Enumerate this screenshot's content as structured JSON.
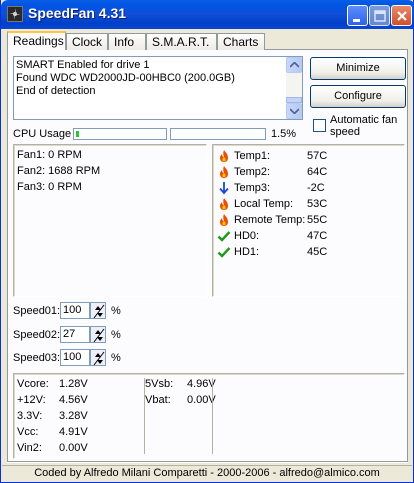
{
  "window": {
    "title": "SpeedFan 4.31"
  },
  "tabs": [
    {
      "label": "Readings",
      "active": true
    },
    {
      "label": "Clock"
    },
    {
      "label": "Info"
    },
    {
      "label": "S.M.A.R.T."
    },
    {
      "label": "Charts"
    }
  ],
  "log": {
    "lines": [
      "SMART Enabled for drive 1",
      "Found WDC WD2000JD-00HBC0 (200.0GB)",
      "End of detection"
    ]
  },
  "buttons": {
    "minimize": "Minimize",
    "configure": "Configure"
  },
  "auto_fan": {
    "label": "Automatic fan speed",
    "checked": false
  },
  "cpu": {
    "label": "CPU Usage",
    "percent_text": "1.5%",
    "cpu1_fraction": 0.03,
    "cpu2_fraction": 0.0
  },
  "fans": [
    {
      "text": "Fan1: 0 RPM"
    },
    {
      "text": "Fan2: 1688 RPM"
    },
    {
      "text": "Fan3: 0 RPM"
    }
  ],
  "temps": [
    {
      "label": "Temp1:",
      "value": "57C",
      "icon": "flame-icon"
    },
    {
      "label": "Temp2:",
      "value": "64C",
      "icon": "flame-icon"
    },
    {
      "label": "Temp3:",
      "value": "-2C",
      "icon": "arrow-down-icon"
    },
    {
      "label": "Local Temp:",
      "value": "53C",
      "icon": "flame-icon"
    },
    {
      "label": "Remote Temp:",
      "value": "55C",
      "icon": "flame-icon"
    },
    {
      "label": "HD0:",
      "value": "47C",
      "icon": "checkmark-icon"
    },
    {
      "label": "HD1:",
      "value": "45C",
      "icon": "checkmark-icon"
    }
  ],
  "speeds": [
    {
      "label": "Speed01:",
      "value": "100",
      "unit": "%"
    },
    {
      "label": "Speed02:",
      "value": "27",
      "unit": "%"
    },
    {
      "label": "Speed03:",
      "value": "100",
      "unit": "%"
    }
  ],
  "voltages_left": [
    {
      "label": "Vcore:",
      "value": "1.28V"
    },
    {
      "label": "+12V:",
      "value": "4.56V"
    },
    {
      "label": "3.3V:",
      "value": "3.28V"
    },
    {
      "label": "Vcc:",
      "value": "4.91V"
    },
    {
      "label": "Vin2:",
      "value": "0.00V"
    }
  ],
  "voltages_right": [
    {
      "label": "5Vsb:",
      "value": "4.96V"
    },
    {
      "label": "Vbat:",
      "value": "0.00V"
    }
  ],
  "statusbar": {
    "text": "Coded by Alfredo Milani Comparetti - 2000-2006 - alfredo@almico.com"
  },
  "colors": {
    "flame": "#e8500a",
    "arrow": "#1f44d8",
    "check": "#1b9a1b",
    "cpu_bar": "#2ec82e"
  }
}
